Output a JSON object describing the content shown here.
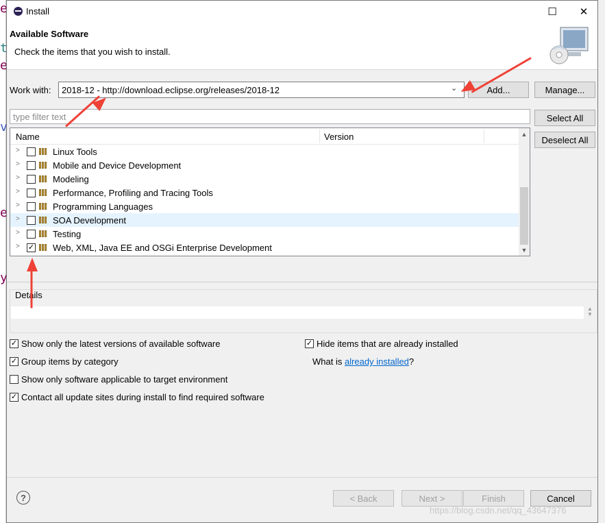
{
  "window": {
    "title": "Install"
  },
  "header": {
    "title": "Available Software",
    "description": "Check the items that you wish to install."
  },
  "work_with": {
    "label": "Work with:",
    "value": "2018-12 - http://download.eclipse.org/releases/2018-12",
    "add_button": "Add...",
    "manage_button": "Manage..."
  },
  "filter": {
    "placeholder": "type filter text"
  },
  "side_buttons": {
    "select_all": "Select All",
    "deselect_all": "Deselect All"
  },
  "tree": {
    "columns": [
      "Name",
      "Version"
    ],
    "rows": [
      {
        "label": "Linux Tools",
        "checked": false
      },
      {
        "label": "Mobile and Device Development",
        "checked": false
      },
      {
        "label": "Modeling",
        "checked": false
      },
      {
        "label": "Performance, Profiling and Tracing Tools",
        "checked": false
      },
      {
        "label": "Programming Languages",
        "checked": false
      },
      {
        "label": "SOA Development",
        "checked": false
      },
      {
        "label": "Testing",
        "checked": false
      },
      {
        "label": "Web, XML, Java EE and OSGi Enterprise Development",
        "checked": true
      }
    ]
  },
  "details": {
    "label": "Details"
  },
  "options": {
    "latest_versions": {
      "label": "Show only the latest versions of available software",
      "checked": true
    },
    "group_by_category": {
      "label": "Group items by category",
      "checked": true
    },
    "target_env": {
      "label": "Show only software applicable to target environment",
      "checked": false
    },
    "contact_sites": {
      "label": "Contact all update sites during install to find required software",
      "checked": true
    },
    "hide_installed": {
      "label": "Hide items that are already installed",
      "checked": true
    },
    "what_is_prefix": "What is ",
    "what_is_link": "already installed",
    "what_is_suffix": "?"
  },
  "footer": {
    "back": "< Back",
    "next": "Next >",
    "finish": "Finish",
    "cancel": "Cancel"
  },
  "watermark": "https://blog.csdn.net/qq_43647376",
  "colors": {
    "annotation_arrow": "#ef4136",
    "link": "#0066cc",
    "selection": "#e5f3ff"
  }
}
